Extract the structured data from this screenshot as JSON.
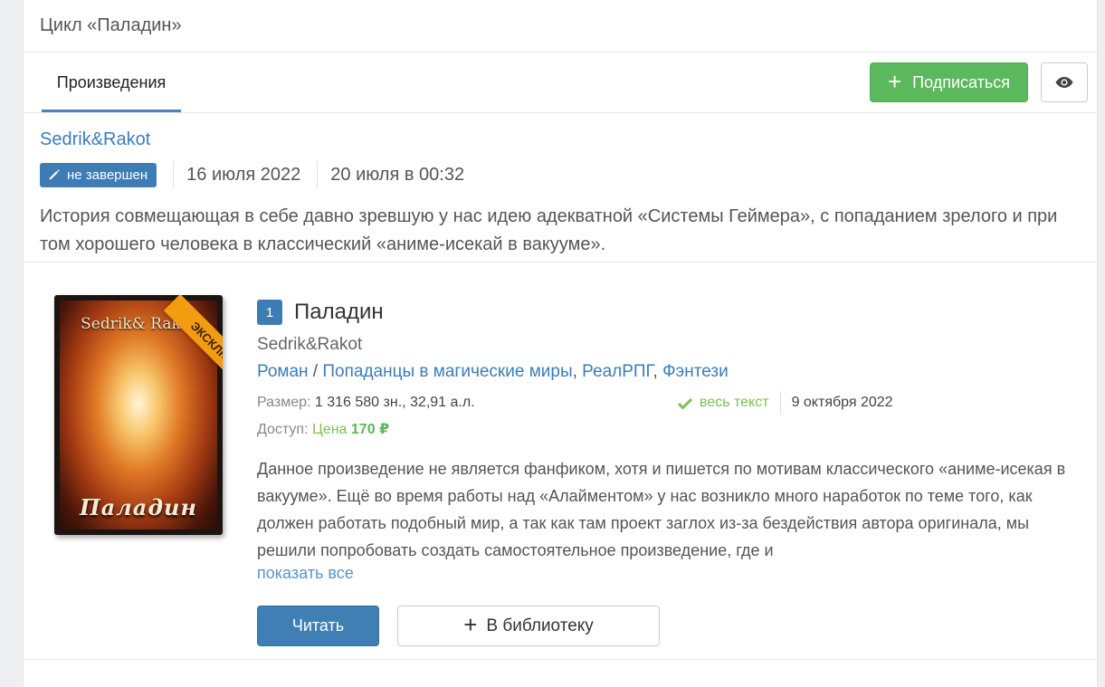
{
  "series": {
    "title": "Цикл «Паладин»",
    "author": "Sedrik&Rakot",
    "status": "не завершен",
    "created": "16 июля 2022",
    "updated": "20 июля в 00:32",
    "description": "История совмещающая в себе давно зревшую у нас идею адекватной «Системы Геймера», с попаданием зрелого и при том хорошего человека в классический «аниме-исекай в вакууме»."
  },
  "tabs": {
    "works": "Произведения"
  },
  "toolbar": {
    "subscribe_label": "Подписаться",
    "subscribe_color": "#5cb85c"
  },
  "work": {
    "number": "1",
    "title": "Паладин",
    "author": "Sedrik&Rakot",
    "ribbon": "ЭКСКЛЮЗИВ",
    "cover_author": "Sedrik& Rakot",
    "cover_title": "Паладин",
    "genres": [
      "Роман",
      "Попаданцы в магические миры",
      "РеалРПГ",
      "Фэнтези"
    ],
    "genre_separators": [
      " / ",
      ", ",
      ", "
    ],
    "size_label": "Размер:",
    "size_value": "1 316 580 зн., 32,91 а.л.",
    "access_label": "Доступ:",
    "price_label": "Цена",
    "price_value": "170 ₽",
    "fulltext_label": "весь текст",
    "date": "9 октября 2022",
    "description": "Данное произведение не является фанфиком, хотя и пишется по мотивам классического «аниме-исекая в вакууме». Ещё во время работы над «Алайментом» у нас возникло много наработок по теме того, как должен работать подобный мир, а так как там проект заглох из-за бездействия автора оригинала, мы решили попробовать создать самостоятельное произведение, где и",
    "show_all": "показать все",
    "read_label": "Читать",
    "library_label": "В библиотеку"
  },
  "icons": {
    "pencil": "pencil-icon",
    "check": "check-icon",
    "eye": "eye-icon",
    "plus": "plus-icon"
  },
  "colors": {
    "accent": "#3d7cb4",
    "success": "#5cb85c",
    "ribbon": "#f39c12"
  }
}
